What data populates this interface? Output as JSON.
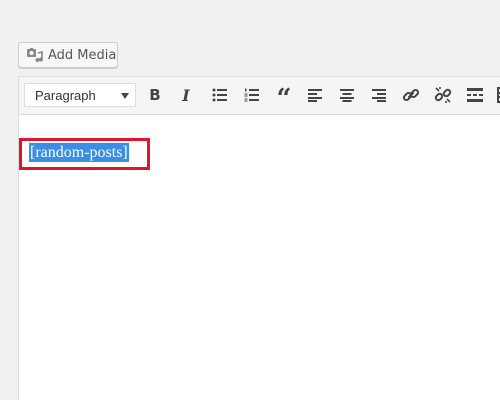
{
  "media": {
    "add_media_label": "Add Media",
    "icon": "media-camera-music-icon"
  },
  "toolbar": {
    "format_selected": "Paragraph",
    "buttons": [
      {
        "name": "bold",
        "glyph": "B"
      },
      {
        "name": "italic",
        "glyph": "I"
      },
      {
        "name": "bulleted-list",
        "icon": "bulleted-list-icon"
      },
      {
        "name": "numbered-list",
        "icon": "numbered-list-icon"
      },
      {
        "name": "blockquote",
        "glyph": "“"
      },
      {
        "name": "align-left",
        "icon": "align-left-icon"
      },
      {
        "name": "align-center",
        "icon": "align-center-icon"
      },
      {
        "name": "align-right",
        "icon": "align-right-icon"
      },
      {
        "name": "insert-link",
        "icon": "link-icon"
      },
      {
        "name": "remove-link",
        "icon": "unlink-icon"
      },
      {
        "name": "read-more",
        "icon": "read-more-icon"
      },
      {
        "name": "toolbar-toggle",
        "icon": "kitchen-sink-icon"
      }
    ]
  },
  "editor": {
    "content_text": "[random-posts]",
    "selection_color": "#3b8ee8",
    "highlight_border_color": "#e0142c"
  }
}
